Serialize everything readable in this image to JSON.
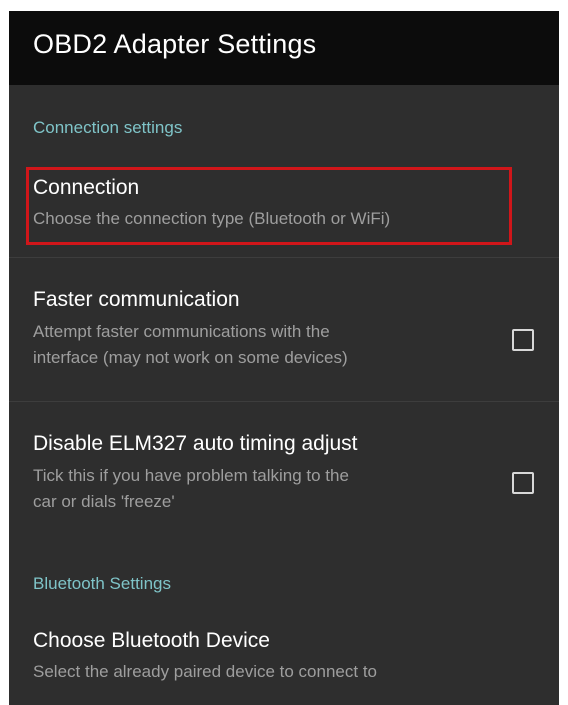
{
  "appbar": {
    "title": "OBD2 Adapter Settings"
  },
  "sections": {
    "connection": {
      "header": "Connection settings",
      "items": {
        "connection": {
          "title": "Connection",
          "summary": "Choose the connection type (Bluetooth or WiFi)"
        },
        "faster": {
          "title": "Faster communication",
          "summary_line1": "Attempt faster communications with the",
          "summary_line2": "interface (may not work on some devices)",
          "checked": false
        },
        "timing": {
          "title": "Disable ELM327 auto timing adjust",
          "summary_line1": "Tick this if you have problem talking to the",
          "summary_line2": "car or dials 'freeze'",
          "checked": false
        }
      }
    },
    "bluetooth": {
      "header": "Bluetooth Settings",
      "items": {
        "device": {
          "title": "Choose Bluetooth Device",
          "summary": "Select the already paired device to connect to"
        }
      }
    }
  },
  "colors": {
    "background": "#2e2e2e",
    "appbar": "#0c0c0c",
    "section_header": "#7fc4c8",
    "highlight": "#d0161a"
  }
}
